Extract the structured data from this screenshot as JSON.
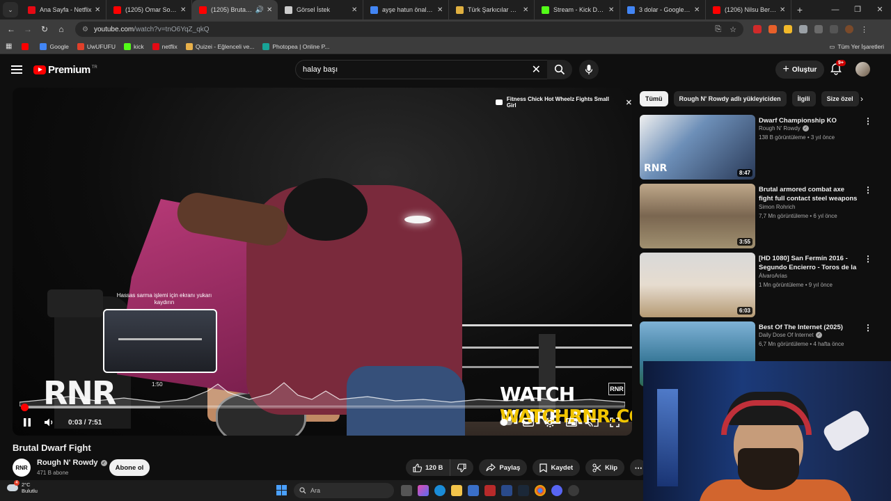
{
  "browser": {
    "tabs": [
      {
        "title": "Ana Sayfa - Netflix",
        "color": "#e50914",
        "active": false
      },
      {
        "title": "(1205) Omar Souleym",
        "color": "#ff0000",
        "active": false
      },
      {
        "title": "(1205) Brutal Dw",
        "color": "#ff0000",
        "active": true
      },
      {
        "title": "Görsel İstek",
        "color": "#cccccc",
        "active": false
      },
      {
        "title": "ayşe hatun önal yaş -",
        "color": "#4285f4",
        "active": false
      },
      {
        "title": "Türk Şarkıcılar Tier Li",
        "color": "#e0b040",
        "active": false
      },
      {
        "title": "Stream - Kick Dashbc",
        "color": "#53fc18",
        "active": false
      },
      {
        "title": "3 dolar - Google'da A",
        "color": "#4285f4",
        "active": false
      },
      {
        "title": "(1206) Nilsu Berfin A",
        "color": "#ff0000",
        "active": false
      }
    ],
    "url_host": "youtube.com",
    "url_path": "/watch?v=tnO6YqZ_qkQ",
    "bookmarks": [
      {
        "label": "Google",
        "color": "#4285f4"
      },
      {
        "label": "UwUFUFU",
        "color": "#e0402a"
      },
      {
        "label": "kick",
        "color": "#53fc18"
      },
      {
        "label": "netflix",
        "color": "#e50914"
      },
      {
        "label": "Quizei - Eğlenceli ve...",
        "color": "#e8b04a"
      },
      {
        "label": "Photopea | Online P...",
        "color": "#18a497"
      }
    ],
    "all_bookmarks": "Tüm Yer İşaretleri"
  },
  "youtube": {
    "logo_text": "Premium",
    "logo_region": "TR",
    "search_query": "halay başı",
    "create_label": "Oluştur",
    "notification_count": "9+"
  },
  "player": {
    "overlay_card": "Fitness Chick Hot Wheelz Fights Small Girl",
    "seek_hint": "Hassas sarma işlemi için ekranı yukarı kaydırın",
    "preview_time": "1:50",
    "watermark": "RNR",
    "watch_more": "WATCH MORE AT",
    "watch_url": "WATCHRNR.COM",
    "badge": "RNR",
    "current_time": "0:03",
    "duration": "7:51",
    "time_display": "0:03 / 7:51",
    "progress_fraction": 0.0064
  },
  "video": {
    "title": "Brutal Dwarf Fight",
    "channel": "Rough N' Rowdy",
    "channel_avatar": "RNR",
    "subscribers": "471 B abone",
    "subscribe_label": "Abone ol",
    "likes": "120 B",
    "share_label": "Paylaş",
    "save_label": "Kaydet",
    "clip_label": "Klip"
  },
  "sidebar": {
    "chips": [
      "Tümü",
      "Rough N' Rowdy adlı yükleyiciden",
      "İlgili",
      "Size özel"
    ],
    "recommendations": [
      {
        "title": "Dwarf Championship KO",
        "channel": "Rough N' Rowdy",
        "verified": true,
        "meta": "138 B görüntüleme • 3 yıl önce",
        "duration": "8:47",
        "mark": "RNR"
      },
      {
        "title": "Brutal armored combat axe fight full contact steel weapons in ...",
        "channel": "Simon Rohrich",
        "verified": false,
        "meta": "7,7 Mn görüntüleme • 6 yıl önce",
        "duration": "3:55",
        "mark": ""
      },
      {
        "title": "[HD 1080] San Fermín 2016 - Segundo Encierro - Toros de la ...",
        "channel": "ÁlvaroArias",
        "verified": false,
        "meta": "1 Mn görüntüleme • 9 yıl önce",
        "duration": "6:03",
        "mark": ""
      },
      {
        "title": "Best Of The Internet (2025)",
        "channel": "Daily Dose Of Internet",
        "verified": true,
        "meta": "6,7 Mn görüntüleme • 4 hafta önce",
        "duration": "",
        "mark": ""
      }
    ]
  },
  "taskbar": {
    "temperature": "2°C",
    "condition": "Bulutlu",
    "weather_badge": "4",
    "search_placeholder": "Ara"
  }
}
